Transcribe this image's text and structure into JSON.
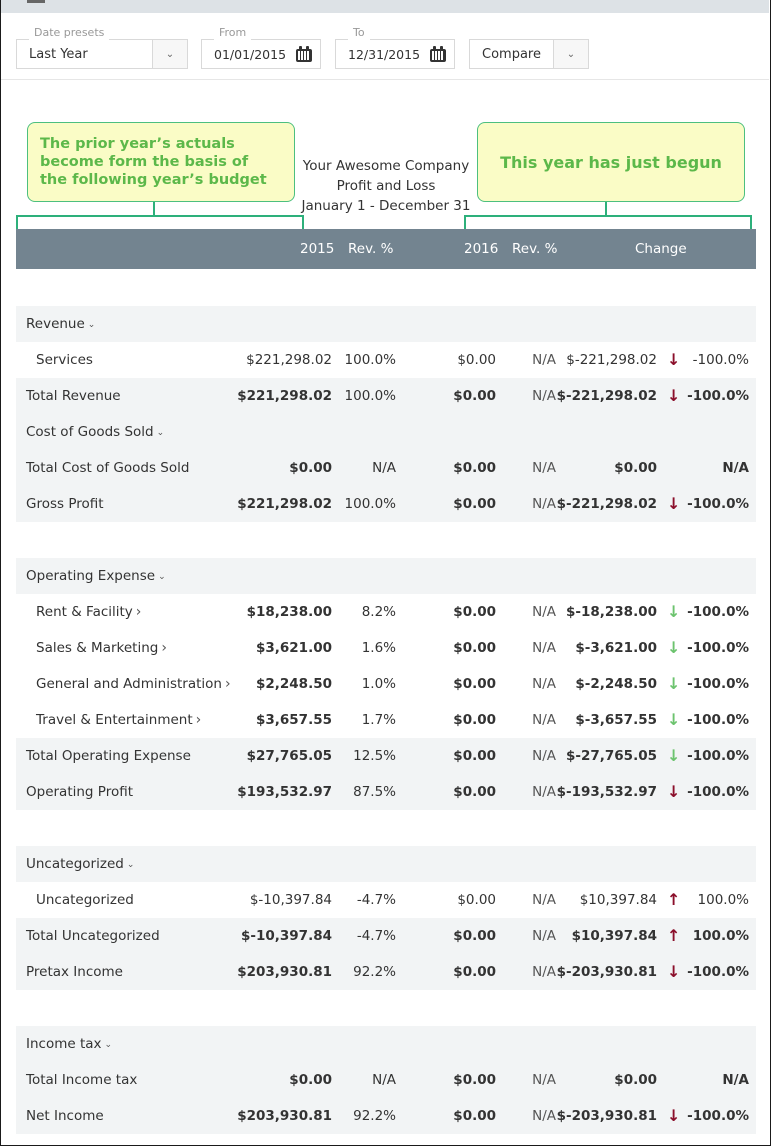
{
  "toolbar": {
    "date_presets": {
      "legend": "Date presets",
      "value": "Last Year"
    },
    "from": {
      "legend": "From",
      "value": "01/01/2015"
    },
    "to": {
      "legend": "To",
      "value": "12/31/2015"
    },
    "compare": {
      "value": "Compare"
    }
  },
  "annotations": {
    "left": [
      "The prior year’s actuals",
      "become form the basis of",
      "the following year’s budget"
    ],
    "right": "This year has just begun",
    "color_text": "#5cb84a",
    "color_border": "#2db07b",
    "color_bg": "#fafcc6"
  },
  "report": {
    "company": "Your Awesome Company",
    "name": "Profit and Loss",
    "period": "January 1 - December 31"
  },
  "columns": {
    "y1": "2015",
    "p1": "Rev. %",
    "y2": "2016",
    "p2": "Rev. %",
    "change": "Change"
  },
  "rows": [
    {
      "label": "Revenue",
      "type": "section",
      "expand": "down"
    },
    {
      "label": "Services",
      "type": "item",
      "v1": "$221,298.02",
      "p1": "100.0%",
      "v2": "$0.00",
      "p2": "N/A",
      "ch": "$-221,298.02",
      "arrow": "down-red",
      "cp": "-100.0%"
    },
    {
      "label": "Total Revenue",
      "type": "total",
      "v1": "$221,298.02",
      "p1": "100.0%",
      "v2": "$0.00",
      "p2": "N/A",
      "ch": "$-221,298.02",
      "arrow": "down-red",
      "cp": "-100.0%"
    },
    {
      "label": "Cost of Goods Sold",
      "type": "section-inline",
      "expand": "down"
    },
    {
      "label": "Total Cost of Goods Sold",
      "type": "total",
      "v1": "$0.00",
      "p1": "N/A",
      "v2": "$0.00",
      "p2": "N/A",
      "ch": "$0.00",
      "arrow": "",
      "cp": "N/A"
    },
    {
      "label": "Gross Profit",
      "type": "total",
      "v1": "$221,298.02",
      "p1": "100.0%",
      "v2": "$0.00",
      "p2": "N/A",
      "ch": "$-221,298.02",
      "arrow": "down-red",
      "cp": "-100.0%"
    },
    {
      "label": "Operating Expense",
      "type": "section",
      "expand": "down"
    },
    {
      "label": "Rent & Facility",
      "type": "item-bold",
      "expand": "right",
      "v1": "$18,238.00",
      "p1": "8.2%",
      "v2": "$0.00",
      "p2": "N/A",
      "ch": "$-18,238.00",
      "arrow": "down-green",
      "cp": "-100.0%"
    },
    {
      "label": "Sales & Marketing",
      "type": "item-bold",
      "expand": "right",
      "v1": "$3,621.00",
      "p1": "1.6%",
      "v2": "$0.00",
      "p2": "N/A",
      "ch": "$-3,621.00",
      "arrow": "down-green",
      "cp": "-100.0%"
    },
    {
      "label": "General and Administration",
      "type": "item-bold",
      "expand": "right",
      "v1": "$2,248.50",
      "p1": "1.0%",
      "v2": "$0.00",
      "p2": "N/A",
      "ch": "$-2,248.50",
      "arrow": "down-green",
      "cp": "-100.0%"
    },
    {
      "label": "Travel & Entertainment",
      "type": "item-bold",
      "expand": "right",
      "v1": "$3,657.55",
      "p1": "1.7%",
      "v2": "$0.00",
      "p2": "N/A",
      "ch": "$-3,657.55",
      "arrow": "down-green",
      "cp": "-100.0%"
    },
    {
      "label": "Total Operating Expense",
      "type": "total",
      "v1": "$27,765.05",
      "p1": "12.5%",
      "v2": "$0.00",
      "p2": "N/A",
      "ch": "$-27,765.05",
      "arrow": "down-green",
      "cp": "-100.0%"
    },
    {
      "label": "Operating Profit",
      "type": "total",
      "v1": "$193,532.97",
      "p1": "87.5%",
      "v2": "$0.00",
      "p2": "N/A",
      "ch": "$-193,532.97",
      "arrow": "down-red",
      "cp": "-100.0%"
    },
    {
      "label": "Uncategorized",
      "type": "section",
      "expand": "down"
    },
    {
      "label": "Uncategorized",
      "type": "item",
      "v1": "$-10,397.84",
      "p1": "-4.7%",
      "v2": "$0.00",
      "p2": "N/A",
      "ch": "$10,397.84",
      "arrow": "up-red",
      "cp": "100.0%"
    },
    {
      "label": "Total Uncategorized",
      "type": "total",
      "v1": "$-10,397.84",
      "p1": "-4.7%",
      "v2": "$0.00",
      "p2": "N/A",
      "ch": "$10,397.84",
      "arrow": "up-red",
      "cp": "100.0%"
    },
    {
      "label": "Pretax Income",
      "type": "total",
      "v1": "$203,930.81",
      "p1": "92.2%",
      "v2": "$0.00",
      "p2": "N/A",
      "ch": "$-203,930.81",
      "arrow": "down-red",
      "cp": "-100.0%"
    },
    {
      "label": "Income tax",
      "type": "section",
      "expand": "down"
    },
    {
      "label": "Total Income tax",
      "type": "total",
      "v1": "$0.00",
      "p1": "N/A",
      "v2": "$0.00",
      "p2": "N/A",
      "ch": "$0.00",
      "arrow": "",
      "cp": "N/A"
    },
    {
      "label": "Net Income",
      "type": "total",
      "v1": "$203,930.81",
      "p1": "92.2%",
      "v2": "$0.00",
      "p2": "N/A",
      "ch": "$-203,930.81",
      "arrow": "down-red",
      "cp": "-100.0%"
    }
  ],
  "colors": {
    "header_bg": "#738490",
    "row_shade": "#f2f4f5",
    "arrow_red": "#8b0f2b",
    "arrow_green": "#6cc36e"
  }
}
